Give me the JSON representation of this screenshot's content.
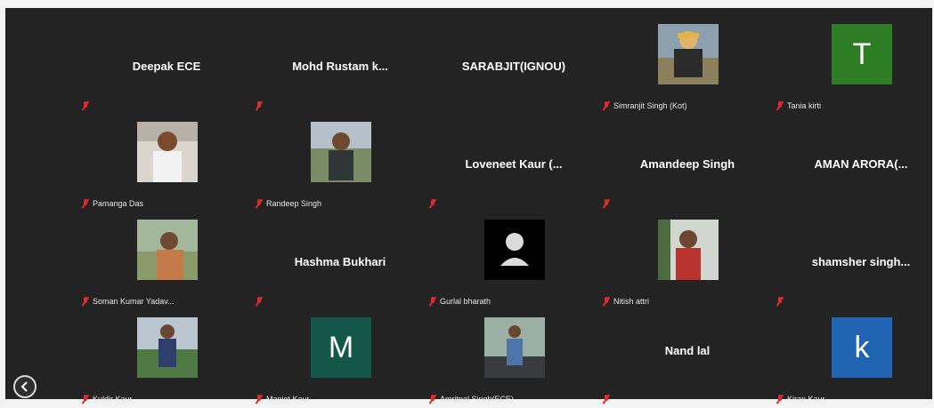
{
  "participants": [
    {
      "display": "Deepak ECE",
      "label": ""
    },
    {
      "display": "Mohd Rustam k...",
      "label": ""
    },
    {
      "display": "SARABJIT(IGNOU)",
      "label": ""
    },
    {
      "display": "",
      "label": "Simranjit Singh (Kot)"
    },
    {
      "display": "T",
      "label": "Tania kirti"
    },
    {
      "display": "",
      "label": "Pamanga Das"
    },
    {
      "display": "",
      "label": "Randeep Singh"
    },
    {
      "display": "Loveneet Kaur (...",
      "label": ""
    },
    {
      "display": "Amandeep Singh",
      "label": ""
    },
    {
      "display": "AMAN ARORA(...",
      "label": ""
    },
    {
      "display": "",
      "label": "Soman Kumar Yadav..."
    },
    {
      "display": "Hashma Bukhari",
      "label": ""
    },
    {
      "display": "",
      "label": "Gurlal bharath"
    },
    {
      "display": "",
      "label": "Nitish attri"
    },
    {
      "display": "shamsher singh...",
      "label": ""
    },
    {
      "display": "",
      "label": "Kuldir Kaur"
    },
    {
      "display": "M",
      "label": "Manjot Kaur"
    },
    {
      "display": "",
      "label": "Amritpal Singh(ECE)"
    },
    {
      "display": "Nand lal",
      "label": ""
    },
    {
      "display": "k",
      "label": "Kiran Kaur"
    }
  ],
  "icons": {
    "mic": "muted-mic-icon",
    "back": "back-arrow-icon"
  }
}
